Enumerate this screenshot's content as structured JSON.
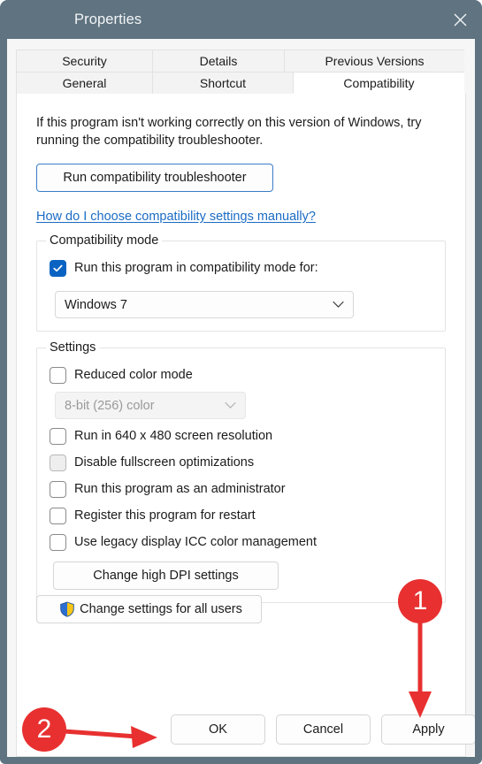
{
  "window": {
    "title": "Properties",
    "close_icon": "close-icon",
    "accent_titlebar": "#5f7380"
  },
  "tabs": {
    "row1": [
      {
        "label": "Security",
        "selected": false
      },
      {
        "label": "Details",
        "selected": false
      },
      {
        "label": "Previous Versions",
        "selected": false
      }
    ],
    "row2": [
      {
        "label": "General",
        "selected": false
      },
      {
        "label": "Shortcut",
        "selected": false
      },
      {
        "label": "Compatibility",
        "selected": true
      }
    ]
  },
  "compatibility_tab": {
    "intro": "If this program isn't working correctly on this version of Windows, try running the compatibility troubleshooter.",
    "troubleshooter_button": "Run compatibility troubleshooter",
    "help_link": "How do I choose compatibility settings manually?",
    "compatibility_mode": {
      "group_title": "Compatibility mode",
      "checkbox_label": "Run this program in compatibility mode for:",
      "checkbox_checked": true,
      "os_selected": "Windows 7",
      "chevron_icon": "chevron-down-icon"
    },
    "settings": {
      "group_title": "Settings",
      "items": [
        {
          "label": "Reduced color mode",
          "checked": false,
          "disabled": false
        },
        {
          "label": "Run in 640 x 480 screen resolution",
          "checked": false,
          "disabled": false
        },
        {
          "label": "Disable fullscreen optimizations",
          "checked": false,
          "disabled": true
        },
        {
          "label": "Run this program as an administrator",
          "checked": false,
          "disabled": false
        },
        {
          "label": "Register this program for restart",
          "checked": false,
          "disabled": false
        },
        {
          "label": "Use legacy display ICC color management",
          "checked": false,
          "disabled": false
        }
      ],
      "color_depth_selected": "8-bit (256) color",
      "color_depth_disabled": true,
      "chevron_icon": "chevron-down-icon",
      "dpi_button": "Change high DPI settings"
    },
    "all_users_button": {
      "label": "Change settings for all users",
      "icon": "uac-shield-icon"
    }
  },
  "footer": {
    "ok": "OK",
    "cancel": "Cancel",
    "apply": "Apply"
  },
  "annotations": {
    "marker_color": "#e83030",
    "markers": [
      {
        "number": "1",
        "points_to": "Apply"
      },
      {
        "number": "2",
        "points_to": "OK"
      }
    ]
  }
}
